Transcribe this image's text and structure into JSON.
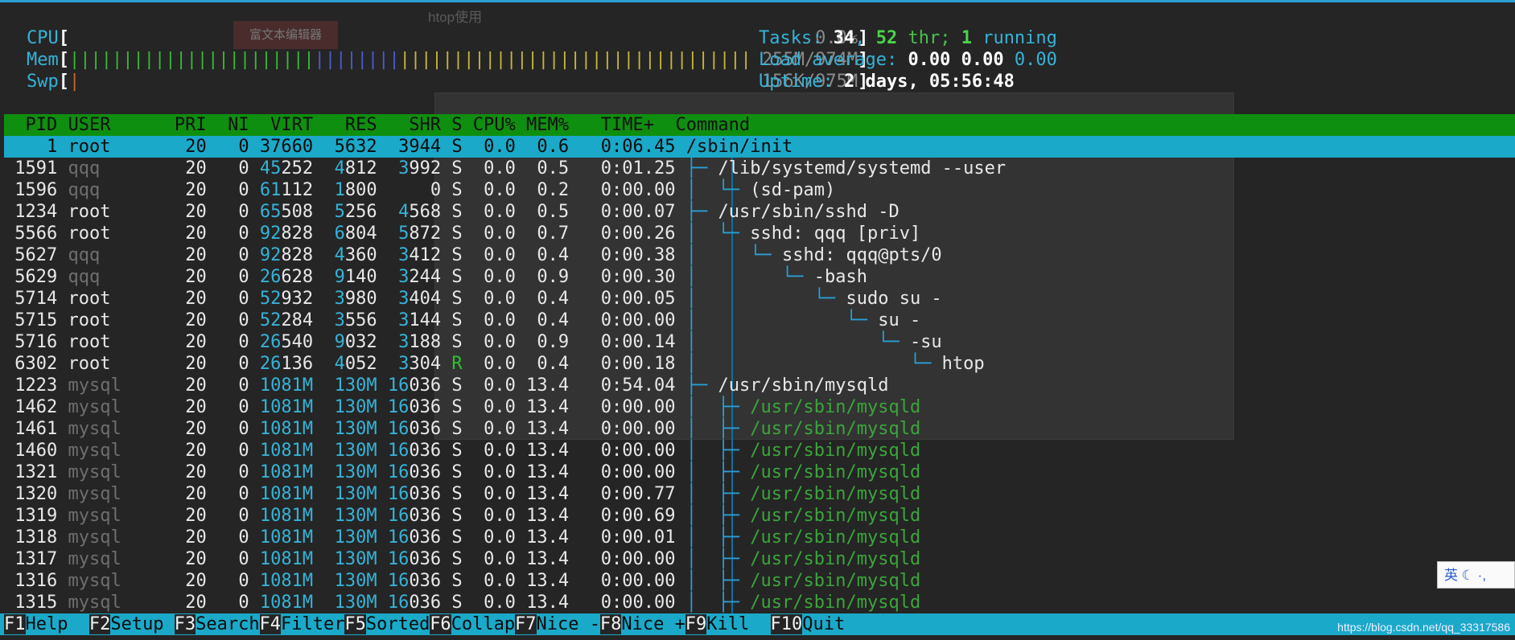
{
  "meters": [
    {
      "label": "CPU",
      "bar": "",
      "value": "0.0%"
    },
    {
      "label": "Mem",
      "bar": "||||||||||||||||||||||||||||||||||||||||||||||||||||||||||||||||||||||||||||||||",
      "value": "255M/974M"
    },
    {
      "label": "Swp",
      "bar": "|",
      "value": "156K/975M"
    }
  ],
  "stats": {
    "tasks_label": "Tasks:",
    "tasks": "34",
    "thr": "52",
    "thr_label": "thr;",
    "running": "1",
    "running_label": "running",
    "load_label": "Load average:",
    "load1": "0.00",
    "load5": "0.00",
    "load15": "0.00",
    "uptime_label": "Uptime:",
    "uptime": "2 days, 05:56:48"
  },
  "header": "  PID USER      PRI  NI  VIRT   RES   SHR S CPU% MEM%   TIME+  Command",
  "rows": [
    {
      "pid": "1",
      "user": "root",
      "pri": "20",
      "ni": "0",
      "virt": "37660",
      "res": "5632",
      "shr": "3944",
      "s": "S",
      "cpu": "0.0",
      "mem": "0.6",
      "time": "0:06.45",
      "tree": "",
      "cmd": "/sbin/init",
      "selected": true
    },
    {
      "pid": "1591",
      "user": "qqq",
      "pri": "20",
      "ni": "0",
      "virt": "45252",
      "res": "4812",
      "shr": "3992",
      "s": "S",
      "cpu": "0.0",
      "mem": "0.5",
      "time": "0:01.25",
      "tree": "├─ ",
      "cmd": "/lib/systemd/systemd --user"
    },
    {
      "pid": "1596",
      "user": "qqq",
      "pri": "20",
      "ni": "0",
      "virt": "61112",
      "res": "1800",
      "shr": "0",
      "s": "S",
      "cpu": "0.0",
      "mem": "0.2",
      "time": "0:00.00",
      "tree": "│  └─ ",
      "cmd": "(sd-pam)"
    },
    {
      "pid": "1234",
      "user": "root",
      "pri": "20",
      "ni": "0",
      "virt": "65508",
      "res": "5256",
      "shr": "4568",
      "s": "S",
      "cpu": "0.0",
      "mem": "0.5",
      "time": "0:00.07",
      "tree": "├─ ",
      "cmd": "/usr/sbin/sshd -D"
    },
    {
      "pid": "5566",
      "user": "root",
      "pri": "20",
      "ni": "0",
      "virt": "92828",
      "res": "6804",
      "shr": "5872",
      "s": "S",
      "cpu": "0.0",
      "mem": "0.7",
      "time": "0:00.26",
      "tree": "│  └─ ",
      "cmd": "sshd: qqq [priv]"
    },
    {
      "pid": "5627",
      "user": "qqq",
      "pri": "20",
      "ni": "0",
      "virt": "92828",
      "res": "4360",
      "shr": "3412",
      "s": "S",
      "cpu": "0.0",
      "mem": "0.4",
      "time": "0:00.38",
      "tree": "│     └─ ",
      "cmd": "sshd: qqq@pts/0"
    },
    {
      "pid": "5629",
      "user": "qqq",
      "pri": "20",
      "ni": "0",
      "virt": "26628",
      "res": "9140",
      "shr": "3244",
      "s": "S",
      "cpu": "0.0",
      "mem": "0.9",
      "time": "0:00.30",
      "tree": "│        └─ ",
      "cmd": "-bash"
    },
    {
      "pid": "5714",
      "user": "root",
      "pri": "20",
      "ni": "0",
      "virt": "52932",
      "res": "3980",
      "shr": "3404",
      "s": "S",
      "cpu": "0.0",
      "mem": "0.4",
      "time": "0:00.05",
      "tree": "│           └─ ",
      "cmd": "sudo su -"
    },
    {
      "pid": "5715",
      "user": "root",
      "pri": "20",
      "ni": "0",
      "virt": "52284",
      "res": "3556",
      "shr": "3144",
      "s": "S",
      "cpu": "0.0",
      "mem": "0.4",
      "time": "0:00.00",
      "tree": "│              └─ ",
      "cmd": "su -"
    },
    {
      "pid": "5716",
      "user": "root",
      "pri": "20",
      "ni": "0",
      "virt": "26540",
      "res": "9032",
      "shr": "3188",
      "s": "S",
      "cpu": "0.0",
      "mem": "0.9",
      "time": "0:00.14",
      "tree": "│                 └─ ",
      "cmd": "-su"
    },
    {
      "pid": "6302",
      "user": "root",
      "pri": "20",
      "ni": "0",
      "virt": "26136",
      "res": "4052",
      "shr": "3304",
      "s": "R",
      "cpu": "0.0",
      "mem": "0.4",
      "time": "0:00.18",
      "tree": "│                    └─ ",
      "cmd": "htop"
    },
    {
      "pid": "1223",
      "user": "mysql",
      "pri": "20",
      "ni": "0",
      "virt": "1081M",
      "res": "130M",
      "shr": "16036",
      "s": "S",
      "cpu": "0.0",
      "mem": "13.4",
      "time": "0:54.04",
      "tree": "├─ ",
      "cmd": "/usr/sbin/mysqld"
    },
    {
      "pid": "1462",
      "user": "mysql",
      "pri": "20",
      "ni": "0",
      "virt": "1081M",
      "res": "130M",
      "shr": "16036",
      "s": "S",
      "cpu": "0.0",
      "mem": "13.4",
      "time": "0:00.00",
      "tree": "│  ├─ ",
      "cmd": "/usr/sbin/mysqld",
      "thread": true
    },
    {
      "pid": "1461",
      "user": "mysql",
      "pri": "20",
      "ni": "0",
      "virt": "1081M",
      "res": "130M",
      "shr": "16036",
      "s": "S",
      "cpu": "0.0",
      "mem": "13.4",
      "time": "0:00.00",
      "tree": "│  ├─ ",
      "cmd": "/usr/sbin/mysqld",
      "thread": true
    },
    {
      "pid": "1460",
      "user": "mysql",
      "pri": "20",
      "ni": "0",
      "virt": "1081M",
      "res": "130M",
      "shr": "16036",
      "s": "S",
      "cpu": "0.0",
      "mem": "13.4",
      "time": "0:00.00",
      "tree": "│  ├─ ",
      "cmd": "/usr/sbin/mysqld",
      "thread": true
    },
    {
      "pid": "1321",
      "user": "mysql",
      "pri": "20",
      "ni": "0",
      "virt": "1081M",
      "res": "130M",
      "shr": "16036",
      "s": "S",
      "cpu": "0.0",
      "mem": "13.4",
      "time": "0:00.00",
      "tree": "│  ├─ ",
      "cmd": "/usr/sbin/mysqld",
      "thread": true
    },
    {
      "pid": "1320",
      "user": "mysql",
      "pri": "20",
      "ni": "0",
      "virt": "1081M",
      "res": "130M",
      "shr": "16036",
      "s": "S",
      "cpu": "0.0",
      "mem": "13.4",
      "time": "0:00.77",
      "tree": "│  ├─ ",
      "cmd": "/usr/sbin/mysqld",
      "thread": true
    },
    {
      "pid": "1319",
      "user": "mysql",
      "pri": "20",
      "ni": "0",
      "virt": "1081M",
      "res": "130M",
      "shr": "16036",
      "s": "S",
      "cpu": "0.0",
      "mem": "13.4",
      "time": "0:00.69",
      "tree": "│  ├─ ",
      "cmd": "/usr/sbin/mysqld",
      "thread": true
    },
    {
      "pid": "1318",
      "user": "mysql",
      "pri": "20",
      "ni": "0",
      "virt": "1081M",
      "res": "130M",
      "shr": "16036",
      "s": "S",
      "cpu": "0.0",
      "mem": "13.4",
      "time": "0:00.01",
      "tree": "│  ├─ ",
      "cmd": "/usr/sbin/mysqld",
      "thread": true
    },
    {
      "pid": "1317",
      "user": "mysql",
      "pri": "20",
      "ni": "0",
      "virt": "1081M",
      "res": "130M",
      "shr": "16036",
      "s": "S",
      "cpu": "0.0",
      "mem": "13.4",
      "time": "0:00.00",
      "tree": "│  ├─ ",
      "cmd": "/usr/sbin/mysqld",
      "thread": true
    },
    {
      "pid": "1316",
      "user": "mysql",
      "pri": "20",
      "ni": "0",
      "virt": "1081M",
      "res": "130M",
      "shr": "16036",
      "s": "S",
      "cpu": "0.0",
      "mem": "13.4",
      "time": "0:00.00",
      "tree": "│  ├─ ",
      "cmd": "/usr/sbin/mysqld",
      "thread": true
    },
    {
      "pid": "1315",
      "user": "mysql",
      "pri": "20",
      "ni": "0",
      "virt": "1081M",
      "res": "130M",
      "shr": "16036",
      "s": "S",
      "cpu": "0.0",
      "mem": "13.4",
      "time": "0:00.00",
      "tree": "│  ├─ ",
      "cmd": "/usr/sbin/mysqld",
      "thread": true
    }
  ],
  "footer": [
    {
      "key": "F1",
      "label": "Help  "
    },
    {
      "key": "F2",
      "label": "Setup "
    },
    {
      "key": "F3",
      "label": "Search"
    },
    {
      "key": "F4",
      "label": "Filter"
    },
    {
      "key": "F5",
      "label": "Sorted"
    },
    {
      "key": "F6",
      "label": "Collap"
    },
    {
      "key": "F7",
      "label": "Nice -"
    },
    {
      "key": "F8",
      "label": "Nice +"
    },
    {
      "key": "F9",
      "label": "Kill  "
    },
    {
      "key": "F10",
      "label": "Quit"
    }
  ],
  "background": {
    "window_title": "htop使用",
    "editor_button": "富文本编辑器"
  },
  "overlay": {
    "url": "https://blog.csdn.net/qq_33317586",
    "ime": "英 ☾ ·,"
  },
  "colors": {
    "terminal_bg": "#252525",
    "header_green": "#0f8f0f",
    "selection_cyan": "#1ba9c9",
    "tree_blue": "#2a9fd6",
    "thread_green": "#3aa63a"
  }
}
